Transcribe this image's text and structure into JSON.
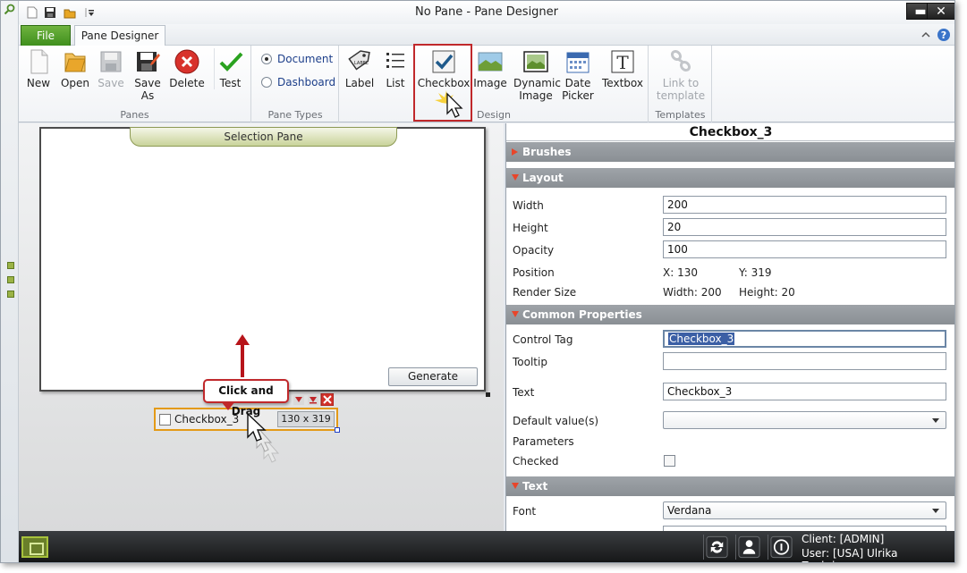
{
  "window": {
    "title": "No Pane - Pane Designer",
    "minimize_glyph": "▬",
    "close_glyph": "✕"
  },
  "tabs": {
    "file": "File",
    "pane_designer": "Pane Designer"
  },
  "ribbon": {
    "panes": {
      "label": "Panes",
      "new": "New",
      "open": "Open",
      "save": "Save",
      "save_as_line1": "Save",
      "save_as_line2": "As",
      "delete": "Delete",
      "test": "Test"
    },
    "pane_types": {
      "label": "Pane Types",
      "document": "Document",
      "dashboard": "Dashboard",
      "selected": "Document"
    },
    "design": {
      "label": "Design",
      "label_btn": "Label",
      "list": "List",
      "checkbox": "Checkbox",
      "image": "Image",
      "dynamic_image_line1": "Dynamic",
      "dynamic_image_line2": "Image",
      "date_picker_line1": "Date",
      "date_picker_line2": "Picker",
      "textbox": "Textbox"
    },
    "templates": {
      "label": "Templates",
      "link_line1": "Link to",
      "link_line2": "template"
    }
  },
  "surface": {
    "selection_pane_title": "Selection Pane",
    "generate": "Generate",
    "callout": "Click and Drag",
    "control_label": "Checkbox_3",
    "control_size": "130 x 319"
  },
  "properties": {
    "title": "Checkbox_3",
    "sections": {
      "brushes": "Brushes",
      "layout": "Layout",
      "common": "Common Properties",
      "text": "Text"
    },
    "layout": {
      "width_label": "Width",
      "width": "200",
      "height_label": "Height",
      "height": "20",
      "opacity_label": "Opacity",
      "opacity": "100",
      "position_label": "Position",
      "pos_x": "X: 130",
      "pos_y": "Y: 319",
      "render_size_label": "Render Size",
      "render_w": "Width: 200",
      "render_h": "Height: 20"
    },
    "common": {
      "control_tag_label": "Control Tag",
      "control_tag": "Checkbox_3",
      "tooltip_label": "Tooltip",
      "tooltip": "",
      "text_label": "Text",
      "text": "Checkbox_3",
      "default_label": "Default value(s)",
      "default": "",
      "parameters_label": "Parameters",
      "checked_label": "Checked"
    },
    "text": {
      "font_label": "Font",
      "font": "Verdana"
    }
  },
  "status": {
    "client": "Client: [ADMIN]",
    "user": "User: [USA] Ulrika Zackrisson"
  },
  "colors": {
    "accent_red": "#c0282b",
    "file_tab_green": "#3f8f1d",
    "section_gray": "#8a8f94"
  }
}
